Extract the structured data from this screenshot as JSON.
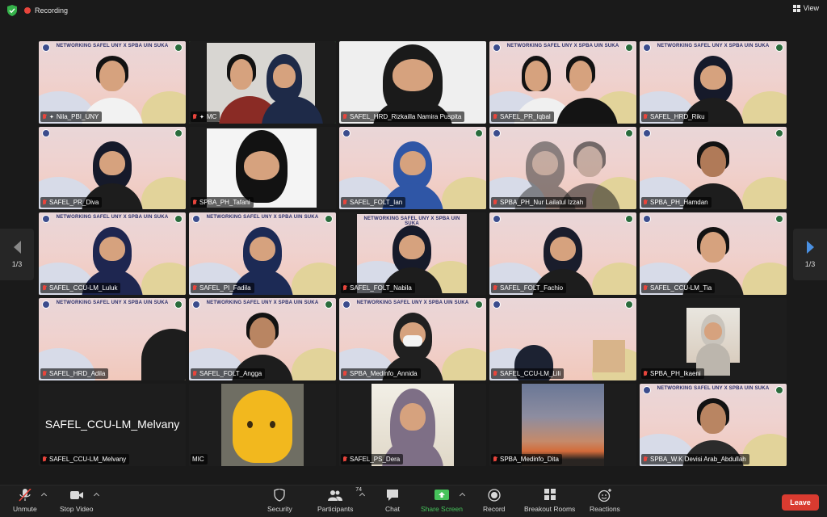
{
  "topbar": {
    "recording_label": "Recording",
    "view_label": "View"
  },
  "pager": {
    "left_label": "1/3",
    "right_label": "1/3"
  },
  "banner_text": "NETWORKING SAFEL UNY X SPBA UIN SUKA",
  "tiles": [
    {
      "name": "Nila_PBI_UNY"
    },
    {
      "name": "MC"
    },
    {
      "name": "SAFEL_HRD_Rizkailla Namira Puspita"
    },
    {
      "name": "SAFEL_PR_Iqbal"
    },
    {
      "name": "SAFEL_HRD_Riku"
    },
    {
      "name": "SAFEL_PR_Diva"
    },
    {
      "name": "SPBA_PH_Tafani"
    },
    {
      "name": "SAFEL_FOLT_Ian"
    },
    {
      "name": "SPBA_PH_Nur Lailatul Izzah"
    },
    {
      "name": "SPBA_PH_Hamdan"
    },
    {
      "name": "SAFEL_CCU-LM_Luluk"
    },
    {
      "name": "SAFEL_PI_Fadila"
    },
    {
      "name": "SAFEL_FOLT_Nabila"
    },
    {
      "name": "SAFEL_FOLT_Fachio"
    },
    {
      "name": "SAFEL_CCU-LM_Tia"
    },
    {
      "name": "SAFEL_HRD_Adila"
    },
    {
      "name": "SAFEL_FOLT_Angga"
    },
    {
      "name": "SPBA_Medinfo_Annida"
    },
    {
      "name": "SAFEL_CCU-LM_Lili"
    },
    {
      "name": "SPBA_PH_Ikaeni"
    },
    {
      "name": "SAFEL_CCU-LM_Melvany",
      "big": "SAFEL_CCU-LM_Melvany"
    },
    {
      "name": "MIC"
    },
    {
      "name": "SAFEL_PS_Dera"
    },
    {
      "name": "SPBA_Medinfo_Dita"
    },
    {
      "name": "SPBA_W.K Devisi Arab_Abdullah"
    }
  ],
  "toolbar": {
    "unmute": "Unmute",
    "stop_video": "Stop Video",
    "security": "Security",
    "participants": "Participants",
    "participants_count": "74",
    "chat": "Chat",
    "share_screen": "Share Screen",
    "record": "Record",
    "breakout": "Breakout Rooms",
    "reactions": "Reactions",
    "leave": "Leave"
  },
  "colors": {
    "accent_green": "#46c35b",
    "leave_red": "#d93b30",
    "recording_red": "#e8453c"
  }
}
